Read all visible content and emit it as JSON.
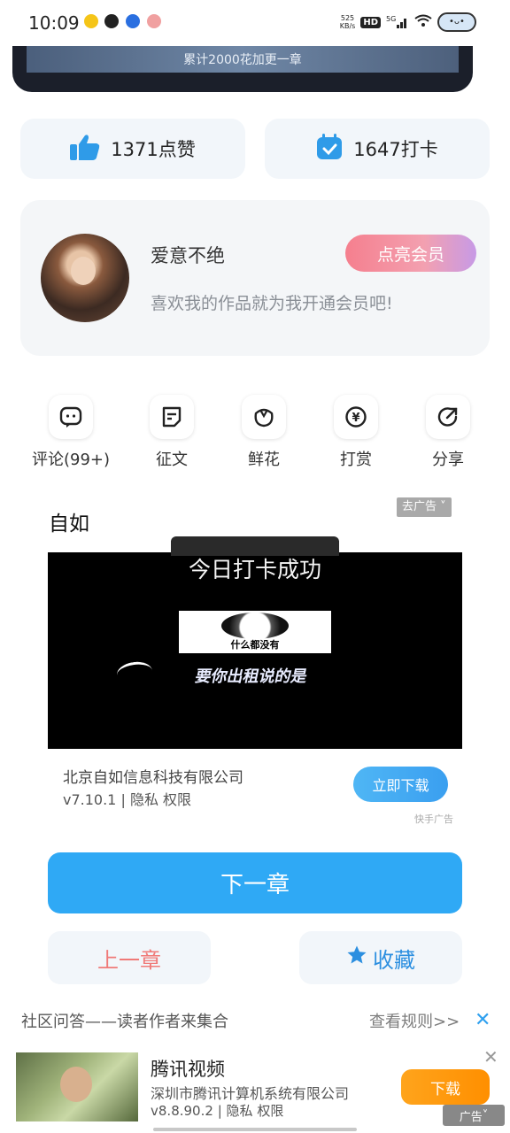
{
  "status_bar": {
    "time": "10:09",
    "net_speed_value": "525",
    "net_speed_unit": "KB/s",
    "hd_label": "HD",
    "network": "5G"
  },
  "banner": {
    "text": "累计2000花加更一章"
  },
  "stats": {
    "likes": "1371点赞",
    "checkins": "1647打卡"
  },
  "author": {
    "name": "爱意不绝",
    "vip_button": "点亮会员",
    "description": "喜欢我的作品就为我开通会员吧!"
  },
  "actions": [
    {
      "label": "评论(99+)",
      "icon": "comment-icon"
    },
    {
      "label": "征文",
      "icon": "essay-icon"
    },
    {
      "label": "鲜花",
      "icon": "flower-icon"
    },
    {
      "label": "打赏",
      "icon": "yuan-reward-icon"
    },
    {
      "label": "分享",
      "icon": "share-icon"
    }
  ],
  "ad": {
    "title": "自如",
    "remove_ad": "去广告",
    "toast": "今日打卡成功",
    "meme_caption": "什么都没有",
    "meme_subtitle": "要你出租说的是",
    "company": "北京自如信息科技有限公司",
    "version": "v7.10.1",
    "privacy": "隐私",
    "permissions": "权限",
    "download_button": "立即下载",
    "source": "快手广告"
  },
  "navigation": {
    "next_chapter": "下一章",
    "prev_chapter": "上一章",
    "collect": "收藏"
  },
  "community": {
    "label": "社区问答——读者作者来集合",
    "rules_link": "查看规则>>"
  },
  "bottom_ad": {
    "title": "腾讯视频",
    "company": "深圳市腾讯计算机系统有限公司",
    "version": "v8.8.90.2",
    "privacy": "隐私",
    "permissions": "权限",
    "download_button": "下载",
    "ad_tag": "广告"
  },
  "colors": {
    "primary_blue": "#2fa9f5",
    "prev_red": "#f07a78",
    "download_orange": "#ff9a10"
  }
}
